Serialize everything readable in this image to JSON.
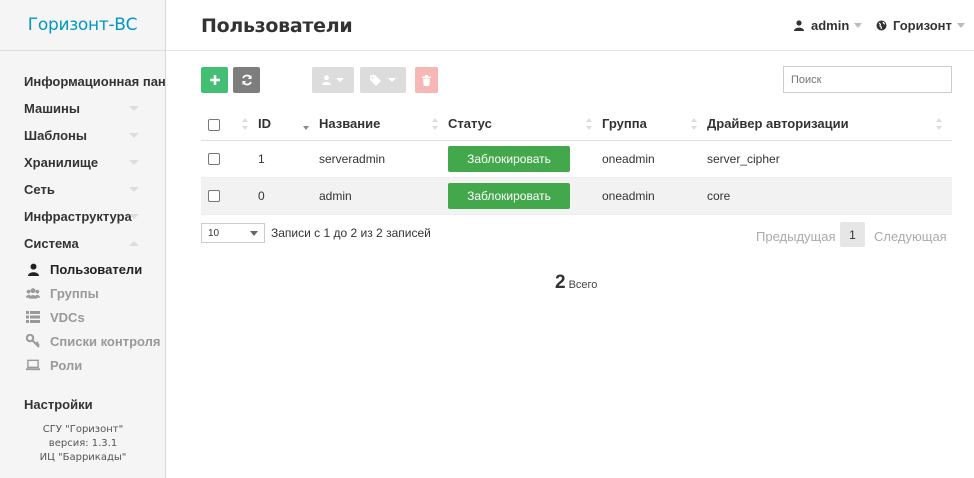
{
  "brand": "Горизонт-ВС",
  "sidebar": {
    "items": [
      {
        "label": "Информационная пане"
      },
      {
        "label": "Машины"
      },
      {
        "label": "Шаблоны"
      },
      {
        "label": "Хранилище"
      },
      {
        "label": "Сеть"
      },
      {
        "label": "Инфраструктура"
      },
      {
        "label": "Система"
      }
    ],
    "subitems": [
      {
        "label": "Пользователи",
        "icon": "user-icon"
      },
      {
        "label": "Группы",
        "icon": "users-icon"
      },
      {
        "label": "VDCs",
        "icon": "list-icon"
      },
      {
        "label": "Списки контроля",
        "icon": "key-icon"
      },
      {
        "label": "Роли",
        "icon": "laptop-icon"
      }
    ],
    "settings": "Настройки",
    "footer": {
      "line1": "СГУ \"Горизонт\"",
      "line2": "версия: 1.3.1",
      "line3": "ИЦ \"Баррикады\""
    }
  },
  "header": {
    "title": "Пользователи",
    "user": "admin",
    "zone": "Горизонт"
  },
  "toolbar": {
    "search_placeholder": "Поиск"
  },
  "table": {
    "columns": [
      "ID",
      "Название",
      "Статус",
      "Группа",
      "Драйвер авторизации"
    ],
    "rows": [
      {
        "id": "1",
        "name": "serveradmin",
        "status": "Заблокировать",
        "group": "oneadmin",
        "driver": "server_cipher"
      },
      {
        "id": "0",
        "name": "admin",
        "status": "Заблокировать",
        "group": "oneadmin",
        "driver": "core"
      }
    ]
  },
  "pagination": {
    "page_length": "10",
    "info": "Записи с 1 до 2 из 2 записей",
    "prev": "Предыдущая",
    "current": "1",
    "next": "Следующая"
  },
  "summary": {
    "count": "2",
    "label": "Всего"
  },
  "colors": {
    "brand": "#0098c3",
    "create_button": "#43bf73",
    "status_button": "#43a84c",
    "delete_button": "#f6b7b5"
  }
}
